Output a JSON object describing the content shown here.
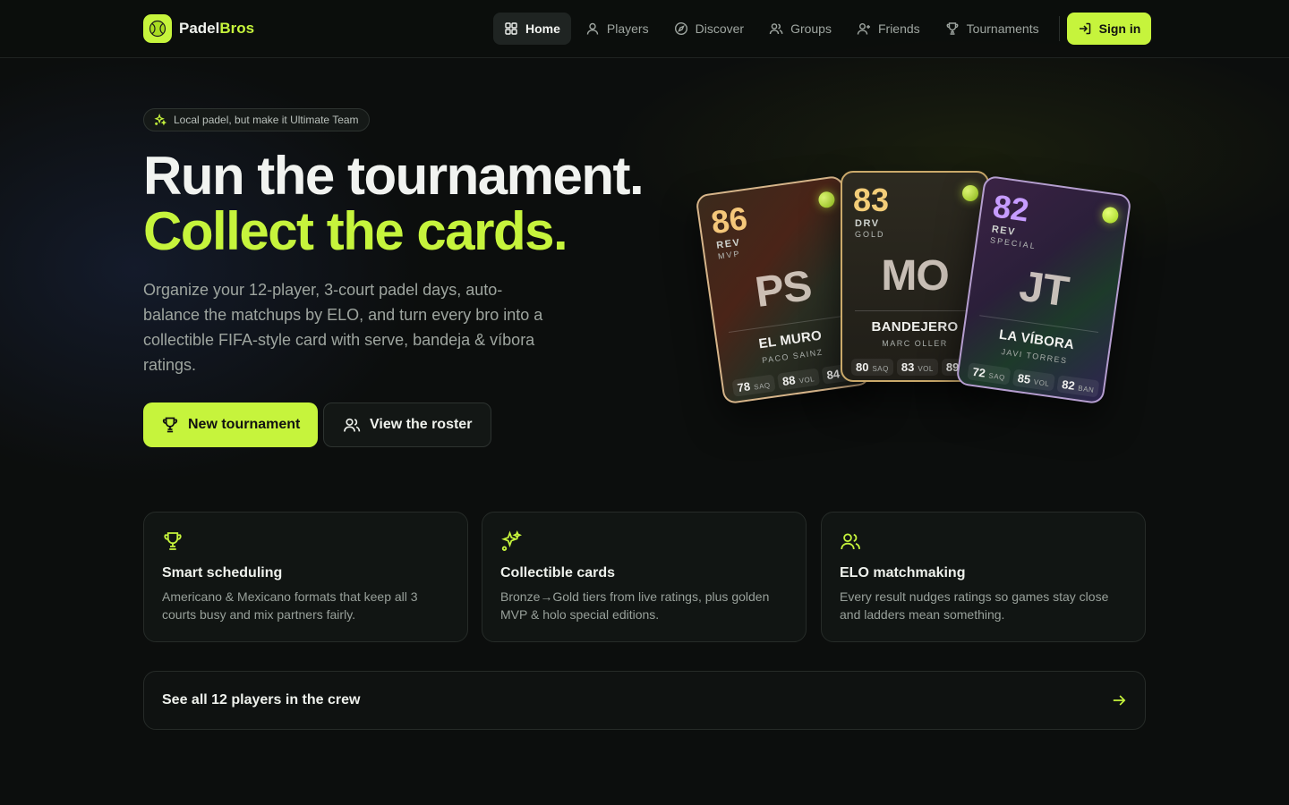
{
  "brand": {
    "name_part1": "Padel",
    "name_part2": "Bros"
  },
  "nav": {
    "items": [
      {
        "label": "Home",
        "icon": "grid-icon",
        "active": true
      },
      {
        "label": "Players",
        "icon": "user-icon"
      },
      {
        "label": "Discover",
        "icon": "compass-icon"
      },
      {
        "label": "Groups",
        "icon": "users-icon"
      },
      {
        "label": "Friends",
        "icon": "user-plus-icon"
      },
      {
        "label": "Tournaments",
        "icon": "trophy-icon"
      }
    ],
    "signin_label": "Sign in"
  },
  "hero": {
    "pill": "Local padel, but make it Ultimate Team",
    "title_line1": "Run the tournament.",
    "title_line2": "Collect the cards.",
    "description": "Organize your 12-player, 3-court padel days, auto-balance the matchups by ELO, and turn every bro into a collectible FIFA-style card with serve, bandeja & víbora ratings.",
    "primary_button": "New tournament",
    "secondary_button": "View the roster"
  },
  "cards": [
    {
      "rating": "86",
      "position": "REV",
      "tier": "MVP",
      "initials": "PS",
      "nickname": "EL MURO",
      "name": "PACO SAINZ",
      "stats": [
        {
          "value": "78",
          "key": "SAQ"
        },
        {
          "value": "88",
          "key": "VOL"
        },
        {
          "value": "84",
          "key": "BAN"
        }
      ]
    },
    {
      "rating": "83",
      "position": "DRV",
      "tier": "GOLD",
      "initials": "MO",
      "nickname": "BANDEJERO",
      "name": "MARC OLLER",
      "stats": [
        {
          "value": "80",
          "key": "SAQ"
        },
        {
          "value": "83",
          "key": "VOL"
        },
        {
          "value": "89",
          "key": "BAN"
        }
      ]
    },
    {
      "rating": "82",
      "position": "REV",
      "tier": "SPECIAL",
      "initials": "JT",
      "nickname": "LA VÍBORA",
      "name": "JAVI TORRES",
      "stats": [
        {
          "value": "72",
          "key": "SAQ"
        },
        {
          "value": "85",
          "key": "VOL"
        },
        {
          "value": "82",
          "key": "BAN"
        }
      ]
    }
  ],
  "features": [
    {
      "icon": "trophy-icon",
      "title": "Smart scheduling",
      "description": "Americano & Mexicano formats that keep all 3 courts busy and mix partners fairly."
    },
    {
      "icon": "sparkles-icon",
      "title": "Collectible cards",
      "description": "Bronze→Gold tiers from live ratings, plus golden MVP & holo special editions."
    },
    {
      "icon": "users-icon",
      "title": "ELO matchmaking",
      "description": "Every result nudges ratings so games stay close and ladders mean something."
    }
  ],
  "crew_link": {
    "label": "See all 12 players in the crew",
    "icon": "arrow-right-icon"
  },
  "colors": {
    "accent": "#c6f43c",
    "background": "#0c0e0d"
  }
}
